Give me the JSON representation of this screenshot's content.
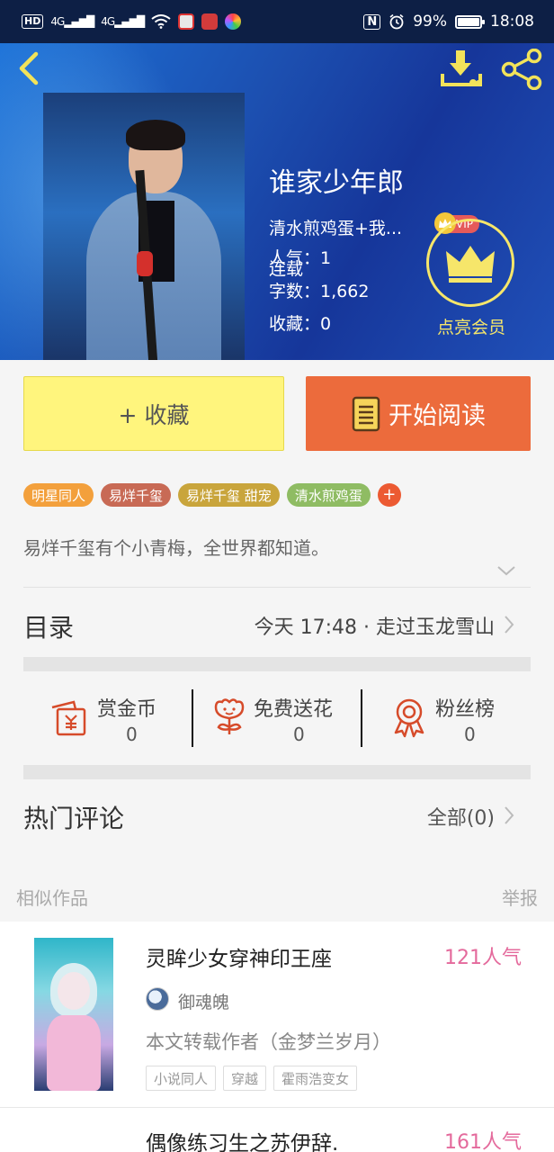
{
  "status_bar": {
    "hd": "HD",
    "signal_1": "4G",
    "signal_2": "4G",
    "nfc": "N",
    "battery": "99%",
    "time": "18:08"
  },
  "header": {
    "title": "谁家少年郎",
    "author": "清水煎鸡蛋+我...",
    "vip": "VIP",
    "status": "连载",
    "stats": [
      {
        "label": "人气：",
        "value": "1"
      },
      {
        "label": "字数：",
        "value": "1,662"
      },
      {
        "label": "收藏：",
        "value": "0"
      }
    ],
    "member_label": "点亮会员"
  },
  "buttons": {
    "collect": "+ 收藏",
    "read": "开始阅读"
  },
  "tags": [
    {
      "label": "明星同人",
      "color": "#f3a03c"
    },
    {
      "label": "易烊千玺",
      "color": "#c86a55"
    },
    {
      "label": "易烊千玺 甜宠",
      "color": "#c9a53c"
    },
    {
      "label": "清水煎鸡蛋",
      "color": "#8fbc63"
    }
  ],
  "tag_more": "+",
  "description": "易烊千玺有个小青梅，全世界都知道。",
  "catalog": {
    "title": "目录",
    "latest": "今天 17:48 · 走过玉龙雪山"
  },
  "actions": [
    {
      "label": "赏金币",
      "count": "0"
    },
    {
      "label": "免费送花",
      "count": "0"
    },
    {
      "label": "粉丝榜",
      "count": "0"
    }
  ],
  "comments": {
    "title": "热门评论",
    "all": "全部(0)"
  },
  "similar": {
    "title": "相似作品",
    "report": "举报"
  },
  "works": [
    {
      "title": "灵眸少女穿神印王座",
      "popularity": "121人气",
      "author": "御魂魄",
      "desc": "本文转载作者（金梦兰岁月）",
      "tags": [
        "小说同人",
        "穿越",
        "霍雨浩变女"
      ]
    },
    {
      "title": "偶像练习生之苏伊辞.",
      "popularity": "161人气"
    }
  ],
  "colors": {
    "accent_orange": "#ec6b3c",
    "collect_yellow": "#fff57d",
    "vip_gold": "#f6e66a",
    "popularity_pink": "#e46a9c",
    "icon_red": "#d64b2a"
  }
}
